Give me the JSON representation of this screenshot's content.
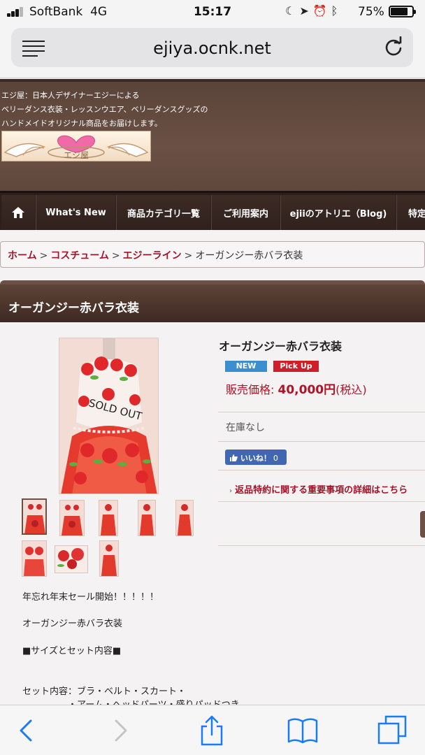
{
  "status_bar": {
    "carrier": "SoftBank",
    "network": "4G",
    "time": "15:17",
    "icons": [
      "moon-icon",
      "location-icon",
      "alarm-icon",
      "bluetooth-icon"
    ],
    "battery_percent": "75%",
    "battery_level": 0.75
  },
  "browser": {
    "url": "ejiya.ocnk.net"
  },
  "site": {
    "tagline": [
      "エジ屋：日本人デザイナーエジーによる",
      "ベリーダンス衣装・レッスンウエア、ベリーダンスグッズの",
      "ハンドメイドオリジナル商品をお届けします。"
    ],
    "logo_text": "エジ屋"
  },
  "nav": {
    "items": [
      {
        "label": ""
      },
      {
        "label": "What's New"
      },
      {
        "label": "商品カテゴリ一覧"
      },
      {
        "label": "ご利用案内"
      },
      {
        "label": "ejiiのアトリエ（Blog)"
      },
      {
        "label": "特定"
      }
    ]
  },
  "breadcrumb": {
    "links": [
      "ホーム",
      "コスチューム",
      "エジーライン"
    ],
    "separator": ">",
    "current": "オーガンジー赤バラ衣装"
  },
  "page_title": "オーガンジー赤バラ衣装",
  "product": {
    "image_overlay": "SOLD OUT",
    "name": "オーガンジー赤バラ衣装",
    "badges": {
      "new": "NEW",
      "pick": "Pick Up"
    },
    "price_label": "販売価格:",
    "price_value": "40,000円",
    "price_tax": "(税込)",
    "stock": "在庫なし",
    "like_label": "いいね！",
    "like_count": "0",
    "notice": "返品特約に関する重要事項の詳細はこちら"
  },
  "description": [
    "年忘れ年末セール開始！！！！！",
    "オーガンジー赤バラ衣装",
    "■サイズとセット内容■",
    "セット内容：ブラ・ベルト・スカート・",
    "　　　　　・アーム・ヘッドパーツ・盛りパッドつき"
  ],
  "colors": {
    "brand_brown": "#5a4339",
    "nav_dark": "#2c1f1b",
    "link_red": "#a0152a",
    "ios_blue": "#1a7cf5"
  }
}
